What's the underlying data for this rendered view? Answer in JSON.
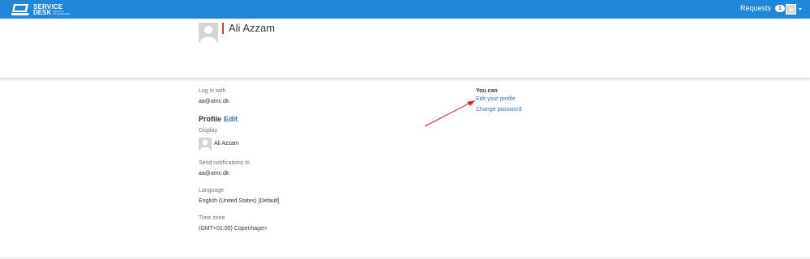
{
  "topbar": {
    "logo": {
      "line1": "SERVICE",
      "line2": "DESK",
      "tagline": "SERVICE MANAGEMENT"
    },
    "requests_label": "Requests",
    "requests_count": "1",
    "colors": {
      "bar": "#1f86d8"
    }
  },
  "header": {
    "title": "Ali Azzam",
    "accent_color": "#d04437"
  },
  "details": {
    "login_label": "Log in with",
    "login_value": "aa@amc.dk",
    "profile_heading": "Profile",
    "profile_edit": "Edit",
    "display_label": "Display",
    "display_value": "Ali Azzam",
    "notifications_label": "Send notifications to",
    "notifications_value": "aa@amc.dk",
    "language_label": "Language",
    "language_value": "English (United States) [Default]",
    "timezone_label": "Time zone",
    "timezone_value": "(GMT+01:00) Copenhagen"
  },
  "sidebar": {
    "heading": "You can",
    "links": [
      {
        "label": "Edit your profile"
      },
      {
        "label": "Change password"
      }
    ],
    "link_color": "#3572b0"
  },
  "annotation": {
    "arrow_color": "#e02020"
  }
}
